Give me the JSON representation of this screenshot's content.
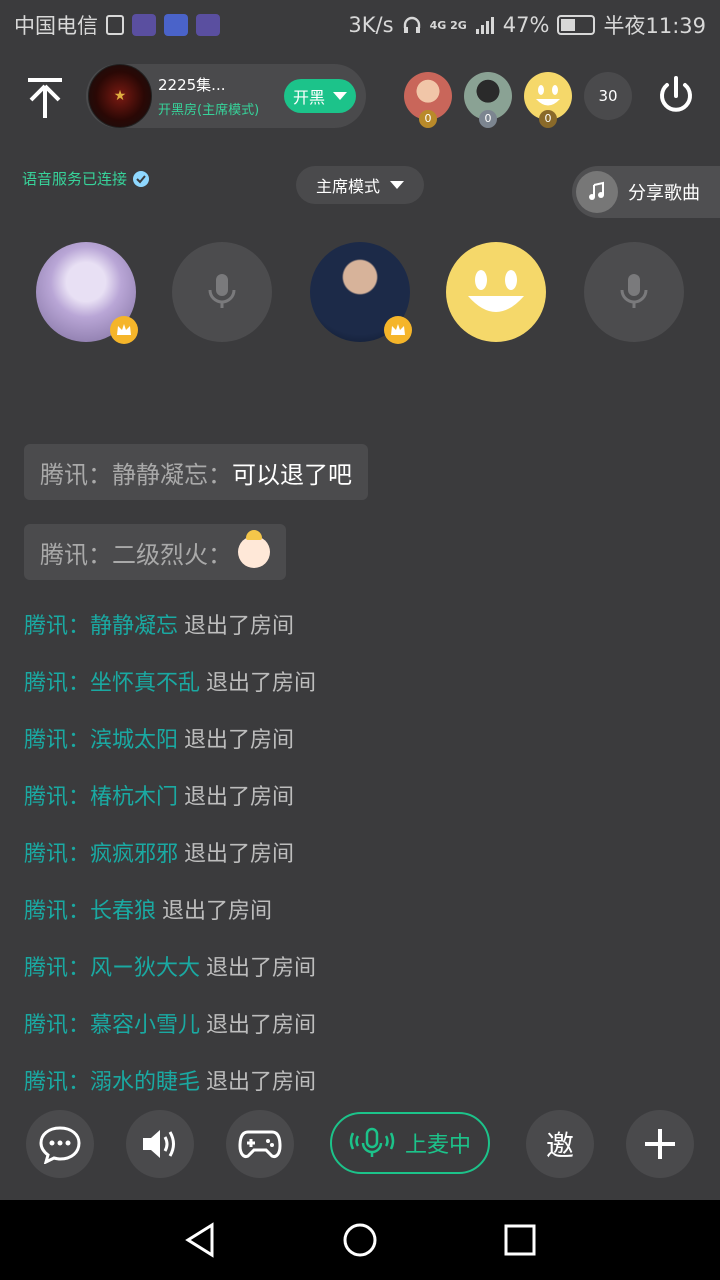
{
  "status_bar": {
    "carrier": "中国电信",
    "speed": "3K/s",
    "network": "4G 2G",
    "battery": "47%",
    "time": "半夜11:39"
  },
  "room": {
    "name": "2225集...",
    "mode_label": "开黑房(主席模式)",
    "open_button": "开黑",
    "member_count": "30",
    "members": [
      {
        "badge": "0",
        "icon": "person-avatar",
        "color": "#c9665a"
      },
      {
        "badge": "0",
        "icon": "person-avatar",
        "color": "#6a8a78"
      },
      {
        "badge": "0",
        "icon": "smiley-avatar",
        "color": "#f5d86a"
      }
    ]
  },
  "voice_status": "语音服务已连接",
  "mode_select": "主席模式",
  "share_song": "分享歌曲",
  "seats": [
    {
      "state": "occupied",
      "crown": true,
      "icon": "winter-tree-avatar"
    },
    {
      "state": "empty",
      "icon": "mic-icon"
    },
    {
      "state": "occupied",
      "crown": true,
      "icon": "player-avatar"
    },
    {
      "state": "occupied",
      "crown": false,
      "icon": "smiley-avatar"
    },
    {
      "state": "empty",
      "icon": "mic-icon"
    }
  ],
  "chat": {
    "messages": [
      {
        "sender": "腾讯：静静凝忘：",
        "text": "可以退了吧"
      },
      {
        "sender": "腾讯：二级烈火：",
        "text": "",
        "emoji": "baby-face-emoji"
      }
    ],
    "system": [
      {
        "prefix": "腾讯：",
        "user": "静静凝忘",
        "action": "退出了房间"
      },
      {
        "prefix": "腾讯：",
        "user": "坐怀真不乱",
        "action": "退出了房间"
      },
      {
        "prefix": "腾讯：",
        "user": "滨城太阳",
        "action": "退出了房间"
      },
      {
        "prefix": "腾讯：",
        "user": "椿杭木门",
        "action": "退出了房间"
      },
      {
        "prefix": "腾讯：",
        "user": "疯疯邪邪",
        "action": "退出了房间"
      },
      {
        "prefix": "腾讯：",
        "user": "长春狼",
        "action": "退出了房间"
      },
      {
        "prefix": "腾讯：",
        "user": "风ー狄大大",
        "action": "退出了房间"
      },
      {
        "prefix": "腾讯：",
        "user": "慕容小雪儿",
        "action": "退出了房间"
      },
      {
        "prefix": "腾讯：",
        "user": "溺水的睫毛",
        "action": "退出了房间"
      }
    ]
  },
  "bottom": {
    "mic_status": "上麦中",
    "invite": "邀"
  },
  "colors": {
    "background": "#3b3b3d",
    "accent": "#1cc38a",
    "system_user": "#1aa9a2",
    "crown": "#f5b52a"
  }
}
